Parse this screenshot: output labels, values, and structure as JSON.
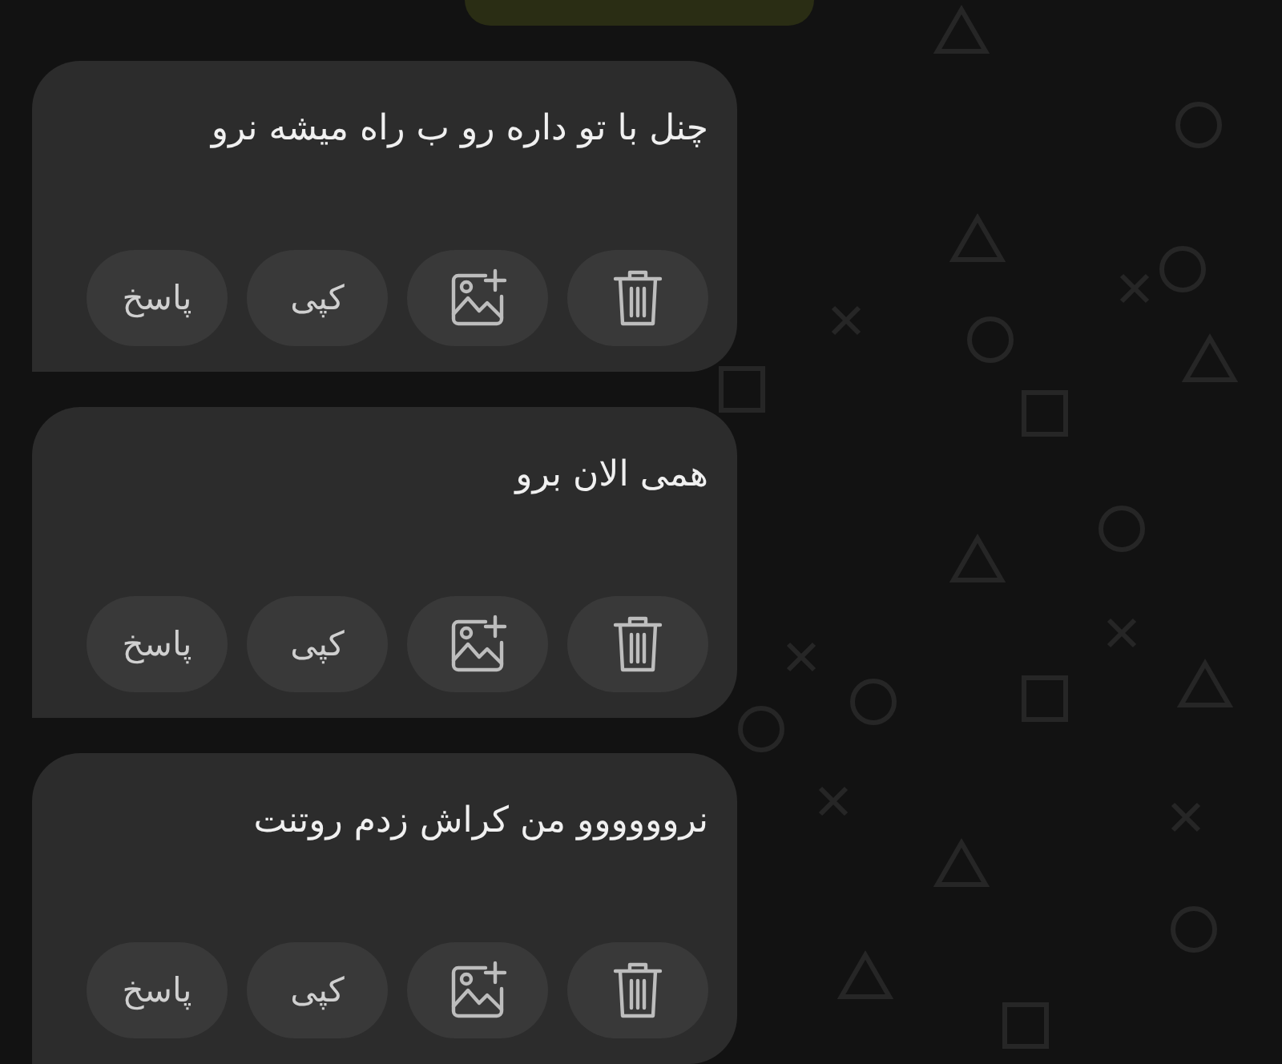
{
  "messages": [
    {
      "text": "چنل با تو داره رو ب راه میشه نرو",
      "actions": [
        {
          "kind": "delete"
        },
        {
          "kind": "add-image"
        },
        {
          "kind": "text",
          "label": "کپی"
        },
        {
          "kind": "text",
          "label": "پاسخ"
        }
      ]
    },
    {
      "text": "همی الان برو",
      "actions": [
        {
          "kind": "delete"
        },
        {
          "kind": "add-image"
        },
        {
          "kind": "text",
          "label": "کپی"
        },
        {
          "kind": "text",
          "label": "پاسخ"
        }
      ]
    },
    {
      "text": "نروووووو من کراش زدم روتنت",
      "actions": [
        {
          "kind": "delete"
        },
        {
          "kind": "add-image"
        },
        {
          "kind": "text",
          "label": "کپی"
        },
        {
          "kind": "text",
          "label": "پاسخ"
        }
      ]
    }
  ]
}
